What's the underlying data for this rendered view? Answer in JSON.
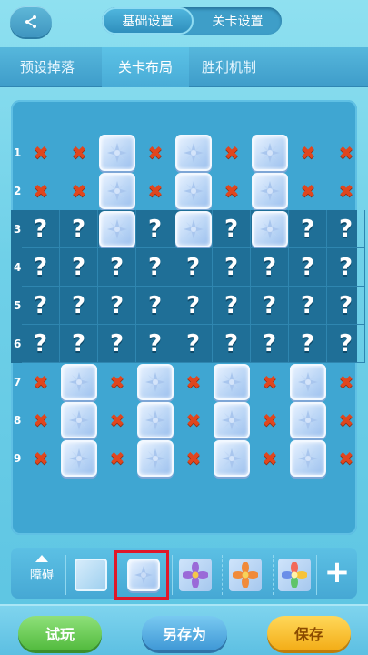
{
  "header": {
    "share_icon": "share-icon",
    "tabs": [
      {
        "label": "基础设置",
        "active": true
      },
      {
        "label": "关卡设置",
        "active": false
      }
    ]
  },
  "subtabs": [
    {
      "label": "预设掉落",
      "active": false
    },
    {
      "label": "关卡布局",
      "active": true
    },
    {
      "label": "胜利机制",
      "active": false
    }
  ],
  "grid": {
    "row_numbers": [
      "1",
      "2",
      "3",
      "4",
      "5",
      "6",
      "7",
      "8",
      "9"
    ],
    "rows": [
      [
        "x",
        "x",
        "tile",
        "x",
        "tile",
        "x",
        "tile",
        "x",
        "x"
      ],
      [
        "x",
        "x",
        "tile",
        "x",
        "tile",
        "x",
        "tile",
        "x",
        "x"
      ],
      [
        "?",
        "?",
        "tile",
        "?",
        "tile",
        "?",
        "tile",
        "?",
        "?"
      ],
      [
        "?",
        "?",
        "?",
        "?",
        "?",
        "?",
        "?",
        "?",
        "?"
      ],
      [
        "?",
        "?",
        "?",
        "?",
        "?",
        "?",
        "?",
        "?",
        "?"
      ],
      [
        "?",
        "?",
        "?",
        "?",
        "?",
        "?",
        "?",
        "?",
        "?"
      ],
      [
        "x",
        "tile",
        "x",
        "tile",
        "x",
        "tile",
        "x",
        "tile",
        "x"
      ],
      [
        "x",
        "tile",
        "x",
        "tile",
        "x",
        "tile",
        "x",
        "tile",
        "x"
      ],
      [
        "x",
        "tile",
        "x",
        "tile",
        "x",
        "tile",
        "x",
        "tile",
        "x"
      ]
    ],
    "x_symbol": "✖",
    "q_symbol": "?"
  },
  "toolbar": {
    "obstacle_label": "障碍",
    "up_icon": "triangle-up-icon",
    "items": [
      "empty-block-icon",
      "ice-block-icon",
      "purple-flower-icon",
      "orange-flower-icon",
      "rainbow-flower-icon"
    ],
    "selected_index": 1,
    "add_label": "+"
  },
  "footer": {
    "try_label": "试玩",
    "save_as_label": "另存为",
    "save_label": "保存"
  },
  "colors": {
    "x_mark": "#e0461e",
    "dark_row": "#1f6f97",
    "selection": "#e0182a"
  }
}
